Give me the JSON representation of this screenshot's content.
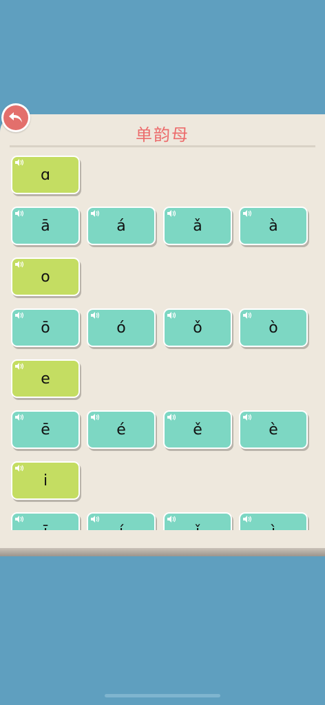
{
  "header": {
    "title": "单韵母"
  },
  "icons": {
    "back": "back-arrow-icon",
    "speaker": "speaker-icon"
  },
  "colors": {
    "background": "#5f9fbf",
    "paper": "#eee8dd",
    "accent": "#e36f6c",
    "teal": "#7dd7c3",
    "green": "#c4dd62"
  },
  "groups": [
    {
      "base": "ɑ",
      "tones": [
        "ā",
        "á",
        "ǎ",
        "à"
      ]
    },
    {
      "base": "o",
      "tones": [
        "ō",
        "ó",
        "ǒ",
        "ò"
      ]
    },
    {
      "base": "e",
      "tones": [
        "ē",
        "é",
        "ě",
        "è"
      ]
    },
    {
      "base": "i",
      "tones": [
        "ī",
        "í",
        "ǐ",
        "ì"
      ]
    }
  ]
}
